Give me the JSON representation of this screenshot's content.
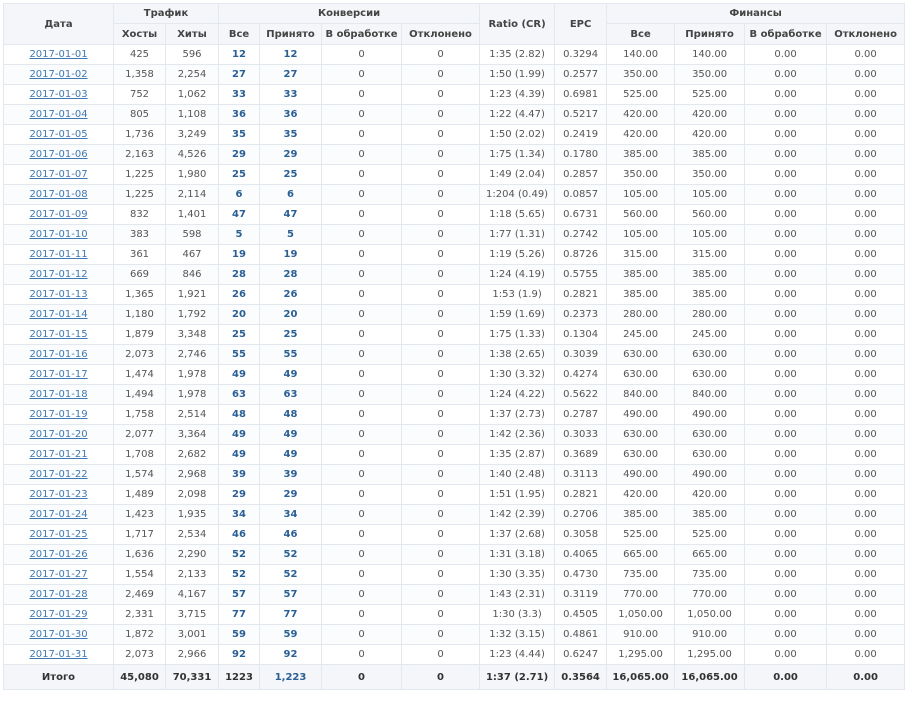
{
  "headers": {
    "date": "Дата",
    "groups": {
      "traffic": "Трафик",
      "conversions": "Конверсии",
      "finance": "Финансы"
    },
    "traffic": {
      "hosts": "Хосты",
      "hits": "Хиты"
    },
    "conversions": {
      "all": "Все",
      "accepted": "Принято",
      "pending": "В обработке",
      "rejected": "Отклонено"
    },
    "ratio": "Ratio (CR)",
    "epc": "EPC",
    "finance": {
      "all": "Все",
      "accepted": "Принято",
      "pending": "В обработке",
      "rejected": "Отклонено"
    }
  },
  "rows": [
    {
      "date": "2017-01-01",
      "hosts": "425",
      "hits": "596",
      "conv_all": "12",
      "conv_acc": "12",
      "conv_pend": "0",
      "conv_rej": "0",
      "ratio": "1:35 (2.82)",
      "epc": "0.3294",
      "fin_all": "140.00",
      "fin_acc": "140.00",
      "fin_pend": "0.00",
      "fin_rej": "0.00"
    },
    {
      "date": "2017-01-02",
      "hosts": "1,358",
      "hits": "2,254",
      "conv_all": "27",
      "conv_acc": "27",
      "conv_pend": "0",
      "conv_rej": "0",
      "ratio": "1:50 (1.99)",
      "epc": "0.2577",
      "fin_all": "350.00",
      "fin_acc": "350.00",
      "fin_pend": "0.00",
      "fin_rej": "0.00"
    },
    {
      "date": "2017-01-03",
      "hosts": "752",
      "hits": "1,062",
      "conv_all": "33",
      "conv_acc": "33",
      "conv_pend": "0",
      "conv_rej": "0",
      "ratio": "1:23 (4.39)",
      "epc": "0.6981",
      "fin_all": "525.00",
      "fin_acc": "525.00",
      "fin_pend": "0.00",
      "fin_rej": "0.00"
    },
    {
      "date": "2017-01-04",
      "hosts": "805",
      "hits": "1,108",
      "conv_all": "36",
      "conv_acc": "36",
      "conv_pend": "0",
      "conv_rej": "0",
      "ratio": "1:22 (4.47)",
      "epc": "0.5217",
      "fin_all": "420.00",
      "fin_acc": "420.00",
      "fin_pend": "0.00",
      "fin_rej": "0.00"
    },
    {
      "date": "2017-01-05",
      "hosts": "1,736",
      "hits": "3,249",
      "conv_all": "35",
      "conv_acc": "35",
      "conv_pend": "0",
      "conv_rej": "0",
      "ratio": "1:50 (2.02)",
      "epc": "0.2419",
      "fin_all": "420.00",
      "fin_acc": "420.00",
      "fin_pend": "0.00",
      "fin_rej": "0.00"
    },
    {
      "date": "2017-01-06",
      "hosts": "2,163",
      "hits": "4,526",
      "conv_all": "29",
      "conv_acc": "29",
      "conv_pend": "0",
      "conv_rej": "0",
      "ratio": "1:75 (1.34)",
      "epc": "0.1780",
      "fin_all": "385.00",
      "fin_acc": "385.00",
      "fin_pend": "0.00",
      "fin_rej": "0.00"
    },
    {
      "date": "2017-01-07",
      "hosts": "1,225",
      "hits": "1,980",
      "conv_all": "25",
      "conv_acc": "25",
      "conv_pend": "0",
      "conv_rej": "0",
      "ratio": "1:49 (2.04)",
      "epc": "0.2857",
      "fin_all": "350.00",
      "fin_acc": "350.00",
      "fin_pend": "0.00",
      "fin_rej": "0.00"
    },
    {
      "date": "2017-01-08",
      "hosts": "1,225",
      "hits": "2,114",
      "conv_all": "6",
      "conv_acc": "6",
      "conv_pend": "0",
      "conv_rej": "0",
      "ratio": "1:204 (0.49)",
      "epc": "0.0857",
      "fin_all": "105.00",
      "fin_acc": "105.00",
      "fin_pend": "0.00",
      "fin_rej": "0.00"
    },
    {
      "date": "2017-01-09",
      "hosts": "832",
      "hits": "1,401",
      "conv_all": "47",
      "conv_acc": "47",
      "conv_pend": "0",
      "conv_rej": "0",
      "ratio": "1:18 (5.65)",
      "epc": "0.6731",
      "fin_all": "560.00",
      "fin_acc": "560.00",
      "fin_pend": "0.00",
      "fin_rej": "0.00"
    },
    {
      "date": "2017-01-10",
      "hosts": "383",
      "hits": "598",
      "conv_all": "5",
      "conv_acc": "5",
      "conv_pend": "0",
      "conv_rej": "0",
      "ratio": "1:77 (1.31)",
      "epc": "0.2742",
      "fin_all": "105.00",
      "fin_acc": "105.00",
      "fin_pend": "0.00",
      "fin_rej": "0.00"
    },
    {
      "date": "2017-01-11",
      "hosts": "361",
      "hits": "467",
      "conv_all": "19",
      "conv_acc": "19",
      "conv_pend": "0",
      "conv_rej": "0",
      "ratio": "1:19 (5.26)",
      "epc": "0.8726",
      "fin_all": "315.00",
      "fin_acc": "315.00",
      "fin_pend": "0.00",
      "fin_rej": "0.00"
    },
    {
      "date": "2017-01-12",
      "hosts": "669",
      "hits": "846",
      "conv_all": "28",
      "conv_acc": "28",
      "conv_pend": "0",
      "conv_rej": "0",
      "ratio": "1:24 (4.19)",
      "epc": "0.5755",
      "fin_all": "385.00",
      "fin_acc": "385.00",
      "fin_pend": "0.00",
      "fin_rej": "0.00"
    },
    {
      "date": "2017-01-13",
      "hosts": "1,365",
      "hits": "1,921",
      "conv_all": "26",
      "conv_acc": "26",
      "conv_pend": "0",
      "conv_rej": "0",
      "ratio": "1:53 (1.9)",
      "epc": "0.2821",
      "fin_all": "385.00",
      "fin_acc": "385.00",
      "fin_pend": "0.00",
      "fin_rej": "0.00"
    },
    {
      "date": "2017-01-14",
      "hosts": "1,180",
      "hits": "1,792",
      "conv_all": "20",
      "conv_acc": "20",
      "conv_pend": "0",
      "conv_rej": "0",
      "ratio": "1:59 (1.69)",
      "epc": "0.2373",
      "fin_all": "280.00",
      "fin_acc": "280.00",
      "fin_pend": "0.00",
      "fin_rej": "0.00"
    },
    {
      "date": "2017-01-15",
      "hosts": "1,879",
      "hits": "3,348",
      "conv_all": "25",
      "conv_acc": "25",
      "conv_pend": "0",
      "conv_rej": "0",
      "ratio": "1:75 (1.33)",
      "epc": "0.1304",
      "fin_all": "245.00",
      "fin_acc": "245.00",
      "fin_pend": "0.00",
      "fin_rej": "0.00"
    },
    {
      "date": "2017-01-16",
      "hosts": "2,073",
      "hits": "2,746",
      "conv_all": "55",
      "conv_acc": "55",
      "conv_pend": "0",
      "conv_rej": "0",
      "ratio": "1:38 (2.65)",
      "epc": "0.3039",
      "fin_all": "630.00",
      "fin_acc": "630.00",
      "fin_pend": "0.00",
      "fin_rej": "0.00"
    },
    {
      "date": "2017-01-17",
      "hosts": "1,474",
      "hits": "1,978",
      "conv_all": "49",
      "conv_acc": "49",
      "conv_pend": "0",
      "conv_rej": "0",
      "ratio": "1:30 (3.32)",
      "epc": "0.4274",
      "fin_all": "630.00",
      "fin_acc": "630.00",
      "fin_pend": "0.00",
      "fin_rej": "0.00"
    },
    {
      "date": "2017-01-18",
      "hosts": "1,494",
      "hits": "1,978",
      "conv_all": "63",
      "conv_acc": "63",
      "conv_pend": "0",
      "conv_rej": "0",
      "ratio": "1:24 (4.22)",
      "epc": "0.5622",
      "fin_all": "840.00",
      "fin_acc": "840.00",
      "fin_pend": "0.00",
      "fin_rej": "0.00"
    },
    {
      "date": "2017-01-19",
      "hosts": "1,758",
      "hits": "2,514",
      "conv_all": "48",
      "conv_acc": "48",
      "conv_pend": "0",
      "conv_rej": "0",
      "ratio": "1:37 (2.73)",
      "epc": "0.2787",
      "fin_all": "490.00",
      "fin_acc": "490.00",
      "fin_pend": "0.00",
      "fin_rej": "0.00"
    },
    {
      "date": "2017-01-20",
      "hosts": "2,077",
      "hits": "3,364",
      "conv_all": "49",
      "conv_acc": "49",
      "conv_pend": "0",
      "conv_rej": "0",
      "ratio": "1:42 (2.36)",
      "epc": "0.3033",
      "fin_all": "630.00",
      "fin_acc": "630.00",
      "fin_pend": "0.00",
      "fin_rej": "0.00"
    },
    {
      "date": "2017-01-21",
      "hosts": "1,708",
      "hits": "2,682",
      "conv_all": "49",
      "conv_acc": "49",
      "conv_pend": "0",
      "conv_rej": "0",
      "ratio": "1:35 (2.87)",
      "epc": "0.3689",
      "fin_all": "630.00",
      "fin_acc": "630.00",
      "fin_pend": "0.00",
      "fin_rej": "0.00"
    },
    {
      "date": "2017-01-22",
      "hosts": "1,574",
      "hits": "2,968",
      "conv_all": "39",
      "conv_acc": "39",
      "conv_pend": "0",
      "conv_rej": "0",
      "ratio": "1:40 (2.48)",
      "epc": "0.3113",
      "fin_all": "490.00",
      "fin_acc": "490.00",
      "fin_pend": "0.00",
      "fin_rej": "0.00"
    },
    {
      "date": "2017-01-23",
      "hosts": "1,489",
      "hits": "2,098",
      "conv_all": "29",
      "conv_acc": "29",
      "conv_pend": "0",
      "conv_rej": "0",
      "ratio": "1:51 (1.95)",
      "epc": "0.2821",
      "fin_all": "420.00",
      "fin_acc": "420.00",
      "fin_pend": "0.00",
      "fin_rej": "0.00"
    },
    {
      "date": "2017-01-24",
      "hosts": "1,423",
      "hits": "1,935",
      "conv_all": "34",
      "conv_acc": "34",
      "conv_pend": "0",
      "conv_rej": "0",
      "ratio": "1:42 (2.39)",
      "epc": "0.2706",
      "fin_all": "385.00",
      "fin_acc": "385.00",
      "fin_pend": "0.00",
      "fin_rej": "0.00"
    },
    {
      "date": "2017-01-25",
      "hosts": "1,717",
      "hits": "2,534",
      "conv_all": "46",
      "conv_acc": "46",
      "conv_pend": "0",
      "conv_rej": "0",
      "ratio": "1:37 (2.68)",
      "epc": "0.3058",
      "fin_all": "525.00",
      "fin_acc": "525.00",
      "fin_pend": "0.00",
      "fin_rej": "0.00"
    },
    {
      "date": "2017-01-26",
      "hosts": "1,636",
      "hits": "2,290",
      "conv_all": "52",
      "conv_acc": "52",
      "conv_pend": "0",
      "conv_rej": "0",
      "ratio": "1:31 (3.18)",
      "epc": "0.4065",
      "fin_all": "665.00",
      "fin_acc": "665.00",
      "fin_pend": "0.00",
      "fin_rej": "0.00"
    },
    {
      "date": "2017-01-27",
      "hosts": "1,554",
      "hits": "2,133",
      "conv_all": "52",
      "conv_acc": "52",
      "conv_pend": "0",
      "conv_rej": "0",
      "ratio": "1:30 (3.35)",
      "epc": "0.4730",
      "fin_all": "735.00",
      "fin_acc": "735.00",
      "fin_pend": "0.00",
      "fin_rej": "0.00"
    },
    {
      "date": "2017-01-28",
      "hosts": "2,469",
      "hits": "4,167",
      "conv_all": "57",
      "conv_acc": "57",
      "conv_pend": "0",
      "conv_rej": "0",
      "ratio": "1:43 (2.31)",
      "epc": "0.3119",
      "fin_all": "770.00",
      "fin_acc": "770.00",
      "fin_pend": "0.00",
      "fin_rej": "0.00"
    },
    {
      "date": "2017-01-29",
      "hosts": "2,331",
      "hits": "3,715",
      "conv_all": "77",
      "conv_acc": "77",
      "conv_pend": "0",
      "conv_rej": "0",
      "ratio": "1:30 (3.3)",
      "epc": "0.4505",
      "fin_all": "1,050.00",
      "fin_acc": "1,050.00",
      "fin_pend": "0.00",
      "fin_rej": "0.00"
    },
    {
      "date": "2017-01-30",
      "hosts": "1,872",
      "hits": "3,001",
      "conv_all": "59",
      "conv_acc": "59",
      "conv_pend": "0",
      "conv_rej": "0",
      "ratio": "1:32 (3.15)",
      "epc": "0.4861",
      "fin_all": "910.00",
      "fin_acc": "910.00",
      "fin_pend": "0.00",
      "fin_rej": "0.00"
    },
    {
      "date": "2017-01-31",
      "hosts": "2,073",
      "hits": "2,966",
      "conv_all": "92",
      "conv_acc": "92",
      "conv_pend": "0",
      "conv_rej": "0",
      "ratio": "1:23 (4.44)",
      "epc": "0.6247",
      "fin_all": "1,295.00",
      "fin_acc": "1,295.00",
      "fin_pend": "0.00",
      "fin_rej": "0.00"
    }
  ],
  "totals": {
    "label": "Итого",
    "hosts": "45,080",
    "hits": "70,331",
    "conv_all": "1223",
    "conv_acc": "1,223",
    "conv_pend": "0",
    "conv_rej": "0",
    "ratio": "1:37 (2.71)",
    "epc": "0.3564",
    "fin_all": "16,065.00",
    "fin_acc": "16,065.00",
    "fin_pend": "0.00",
    "fin_rej": "0.00"
  },
  "colors": {
    "link": "#3f78b2",
    "conversion_value": "#2a5f95",
    "header_bg": "#f4f6f9",
    "border": "#e3e8ee"
  }
}
